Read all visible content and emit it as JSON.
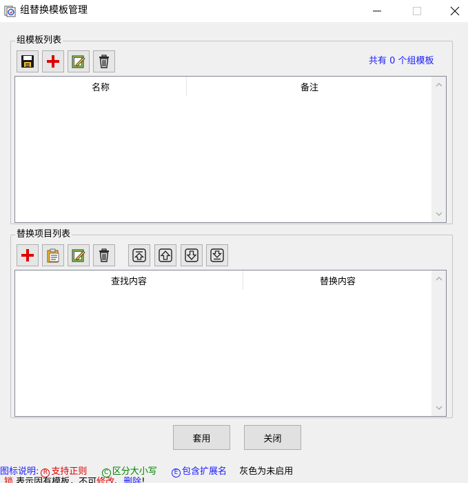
{
  "window": {
    "title": "组替换模板管理",
    "minimize_glyph": "—",
    "close_glyph": "✕"
  },
  "group_templates": {
    "title": "组模板列表",
    "count_text": "共有 0 个组模板",
    "columns": [
      "名称",
      "备注"
    ],
    "rows": [],
    "toolbar": [
      "save-icon",
      "add-icon",
      "edit-icon",
      "delete-icon"
    ]
  },
  "replace_items": {
    "title": "替换项目列表",
    "columns": [
      "查找内容",
      "替换内容"
    ],
    "rows": [],
    "toolbar": [
      "add-icon",
      "paste-icon",
      "edit-icon",
      "delete-icon",
      "move-top-icon",
      "move-up-icon",
      "move-down-icon",
      "move-bottom-icon"
    ]
  },
  "buttons": {
    "apply": "套用",
    "close": "关闭"
  },
  "legend": {
    "prefix": "图标说明:",
    "regex_mark": "R",
    "regex_text": "支持正则",
    "case_mark": "C",
    "case_text": "区分大小写",
    "ext_mark": "E",
    "ext_text": "包含扩展名",
    "gray_text": "灰色为未启用",
    "line2_mark": "锁",
    "line2_a": "表示固有模板，不可",
    "line2_b": "修改",
    "line2_c": "、",
    "line2_d": "删除",
    "line2_e": "!"
  },
  "colors": {
    "accent_blue": "#1a1aff",
    "red": "#e00000",
    "green": "#008000"
  }
}
